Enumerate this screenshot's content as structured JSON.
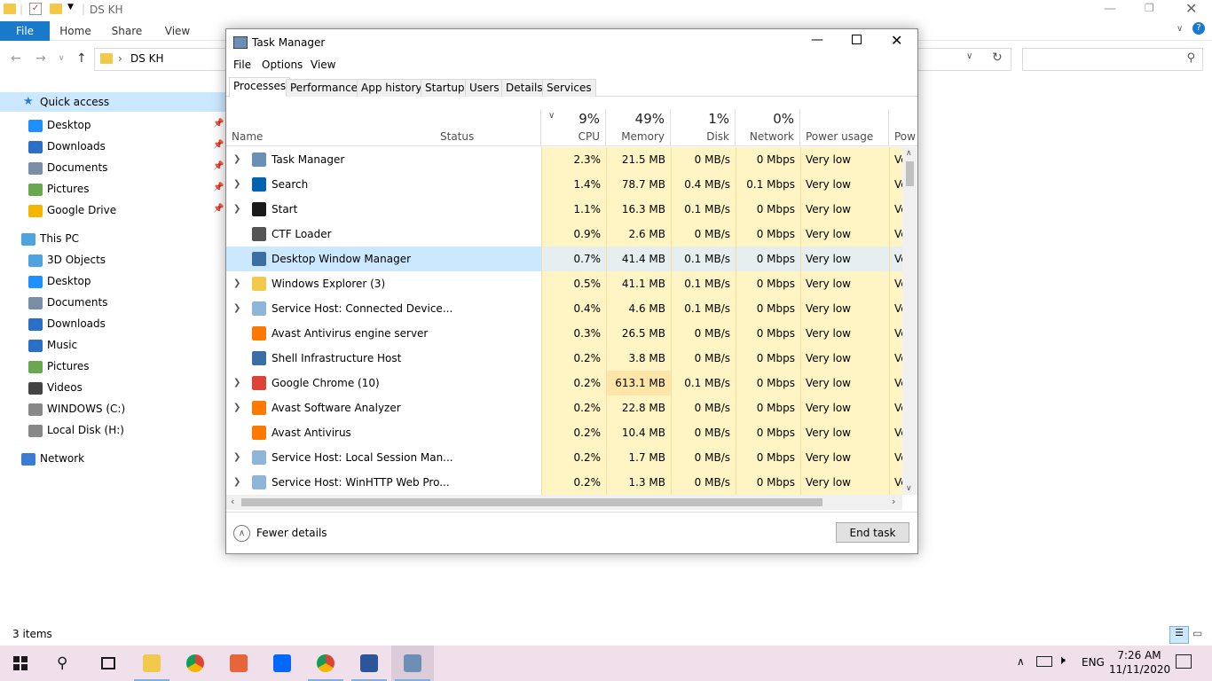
{
  "explorer": {
    "title": "DS KH",
    "ribbon_tabs": [
      "File",
      "Home",
      "Share",
      "View"
    ],
    "address": "DS KH",
    "search_placeholder": "",
    "status": "3 items",
    "quick_access_label": "Quick access",
    "quick_access": [
      {
        "label": "Desktop",
        "icon": "desktop-icon",
        "color": "#1e90ff"
      },
      {
        "label": "Downloads",
        "icon": "download-icon",
        "color": "#2b6fc7"
      },
      {
        "label": "Documents",
        "icon": "documents-icon",
        "color": "#7a8ea8"
      },
      {
        "label": "Pictures",
        "icon": "pictures-icon",
        "color": "#6aa84f"
      },
      {
        "label": "Google Drive",
        "icon": "google-drive-icon",
        "color": "#f4b400"
      }
    ],
    "this_pc_label": "This PC",
    "this_pc": [
      {
        "label": "3D Objects",
        "icon": "3d-objects-icon",
        "color": "#4fa3e0"
      },
      {
        "label": "Desktop",
        "icon": "desktop-icon",
        "color": "#1e90ff"
      },
      {
        "label": "Documents",
        "icon": "documents-icon",
        "color": "#7a8ea8"
      },
      {
        "label": "Downloads",
        "icon": "download-icon",
        "color": "#2b6fc7"
      },
      {
        "label": "Music",
        "icon": "music-icon",
        "color": "#2b6fc7"
      },
      {
        "label": "Pictures",
        "icon": "pictures-icon",
        "color": "#6aa84f"
      },
      {
        "label": "Videos",
        "icon": "videos-icon",
        "color": "#444444"
      },
      {
        "label": "WINDOWS (C:)",
        "icon": "drive-icon",
        "color": "#888888"
      },
      {
        "label": "Local Disk (H:)",
        "icon": "drive-icon",
        "color": "#888888"
      }
    ],
    "network_label": "Network"
  },
  "taskmanager": {
    "title": "Task Manager",
    "menu": [
      "File",
      "Options",
      "View"
    ],
    "tabs": [
      "Processes",
      "Performance",
      "App history",
      "Startup",
      "Users",
      "Details",
      "Services"
    ],
    "columns": {
      "name": "Name",
      "status": "Status",
      "cpu_pct": "9%",
      "cpu": "CPU",
      "mem_pct": "49%",
      "mem": "Memory",
      "disk_pct": "1%",
      "disk": "Disk",
      "net_pct": "0%",
      "net": "Network",
      "power": "Power usage",
      "power_trend": "Pow"
    },
    "processes": [
      {
        "name": "Task Manager",
        "expandable": true,
        "icon": "task-manager-icon",
        "color": "#6b8fb5",
        "cpu": "2.3%",
        "mem": "21.5 MB",
        "disk": "0 MB/s",
        "net": "0 Mbps",
        "power": "Very low",
        "power2": "Ve"
      },
      {
        "name": "Search",
        "expandable": true,
        "icon": "search-icon",
        "color": "#0063b1",
        "cpu": "1.4%",
        "mem": "78.7 MB",
        "disk": "0.4 MB/s",
        "net": "0.1 Mbps",
        "power": "Very low",
        "power2": "Ve"
      },
      {
        "name": "Start",
        "expandable": true,
        "icon": "start-icon",
        "color": "#1a1a1a",
        "cpu": "1.1%",
        "mem": "16.3 MB",
        "disk": "0.1 MB/s",
        "net": "0 Mbps",
        "power": "Very low",
        "power2": "Ve"
      },
      {
        "name": "CTF Loader",
        "expandable": false,
        "icon": "ctf-loader-icon",
        "color": "#555555",
        "cpu": "0.9%",
        "mem": "2.6 MB",
        "disk": "0 MB/s",
        "net": "0 Mbps",
        "power": "Very low",
        "power2": "Ve"
      },
      {
        "name": "Desktop Window Manager",
        "expandable": false,
        "icon": "window-icon",
        "color": "#3a6ea5",
        "cpu": "0.7%",
        "mem": "41.4 MB",
        "disk": "0.1 MB/s",
        "net": "0 Mbps",
        "power": "Very low",
        "power2": "Ve",
        "selected": true
      },
      {
        "name": "Windows Explorer (3)",
        "expandable": true,
        "icon": "folder-icon",
        "color": "#f3c94b",
        "cpu": "0.5%",
        "mem": "41.1 MB",
        "disk": "0.1 MB/s",
        "net": "0 Mbps",
        "power": "Very low",
        "power2": "Ve"
      },
      {
        "name": "Service Host: Connected Device...",
        "expandable": true,
        "icon": "service-gear-icon",
        "color": "#8fb6d8",
        "cpu": "0.4%",
        "mem": "4.6 MB",
        "disk": "0.1 MB/s",
        "net": "0 Mbps",
        "power": "Very low",
        "power2": "Ve"
      },
      {
        "name": "Avast Antivirus engine server",
        "expandable": false,
        "icon": "avast-icon",
        "color": "#ff7800",
        "cpu": "0.3%",
        "mem": "26.5 MB",
        "disk": "0 MB/s",
        "net": "0 Mbps",
        "power": "Very low",
        "power2": "Ve"
      },
      {
        "name": "Shell Infrastructure Host",
        "expandable": false,
        "icon": "window-icon",
        "color": "#3a6ea5",
        "cpu": "0.2%",
        "mem": "3.8 MB",
        "disk": "0 MB/s",
        "net": "0 Mbps",
        "power": "Very low",
        "power2": "Ve"
      },
      {
        "name": "Google Chrome (10)",
        "expandable": true,
        "icon": "chrome-icon",
        "color": "#db4437",
        "cpu": "0.2%",
        "mem": "613.1 MB",
        "disk": "0.1 MB/s",
        "net": "0 Mbps",
        "power": "Very low",
        "power2": "Ve",
        "mem_high": true
      },
      {
        "name": "Avast Software Analyzer",
        "expandable": true,
        "icon": "avast-icon",
        "color": "#ff7800",
        "cpu": "0.2%",
        "mem": "22.8 MB",
        "disk": "0 MB/s",
        "net": "0 Mbps",
        "power": "Very low",
        "power2": "Ve"
      },
      {
        "name": "Avast Antivirus",
        "expandable": false,
        "icon": "avast-icon",
        "color": "#ff7800",
        "cpu": "0.2%",
        "mem": "10.4 MB",
        "disk": "0 MB/s",
        "net": "0 Mbps",
        "power": "Very low",
        "power2": "Ve"
      },
      {
        "name": "Service Host: Local Session Man...",
        "expandable": true,
        "icon": "service-gear-icon",
        "color": "#8fb6d8",
        "cpu": "0.2%",
        "mem": "1.7 MB",
        "disk": "0 MB/s",
        "net": "0 Mbps",
        "power": "Very low",
        "power2": "Ve"
      },
      {
        "name": "Service Host: WinHTTP Web Pro...",
        "expandable": true,
        "icon": "service-gear-icon",
        "color": "#8fb6d8",
        "cpu": "0.2%",
        "mem": "1.3 MB",
        "disk": "0 MB/s",
        "net": "0 Mbps",
        "power": "Very low",
        "power2": "Ve"
      }
    ],
    "fewer_details": "Fewer details",
    "end_task": "End task"
  },
  "taskbar": {
    "apps": [
      {
        "name": "start-button",
        "icon": "windows-logo-icon",
        "color": "#1a1a1a"
      },
      {
        "name": "search-button",
        "icon": "search-icon",
        "color": "#1a1a1a"
      },
      {
        "name": "task-view-button",
        "icon": "task-view-icon",
        "color": "#1a1a1a"
      },
      {
        "name": "file-explorer-button",
        "icon": "folder-icon",
        "color": "#f3c94b",
        "open": true
      },
      {
        "name": "chrome-button",
        "icon": "chrome-icon",
        "color": "#db4437"
      },
      {
        "name": "paint-button",
        "icon": "paint-icon",
        "color": "#e8653a"
      },
      {
        "name": "zalo-button",
        "icon": "zalo-icon",
        "color": "#0068ff"
      },
      {
        "name": "chrome-profile-button",
        "icon": "chrome-icon",
        "color": "#db4437",
        "open": true
      },
      {
        "name": "word-button",
        "icon": "word-icon",
        "color": "#2b579a",
        "open": true
      },
      {
        "name": "task-manager-button",
        "icon": "task-manager-icon",
        "color": "#6b8fb5",
        "open": true,
        "active": true
      }
    ],
    "lang": "ENG",
    "time": "7:26 AM",
    "date": "11/11/2020"
  }
}
